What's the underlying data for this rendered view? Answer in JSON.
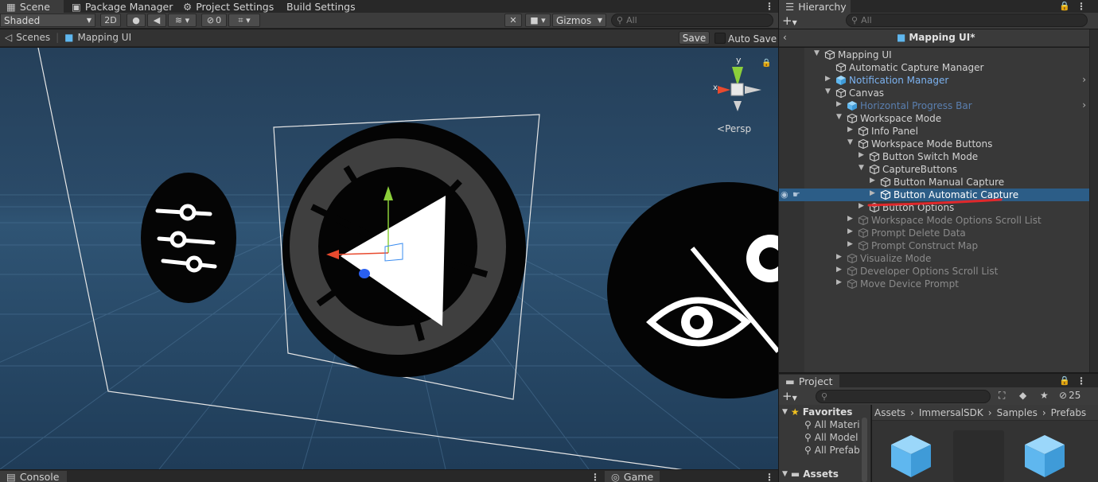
{
  "scene_panel": {
    "tabs": [
      {
        "label": "Scene",
        "icon": "hash-icon",
        "active": true
      },
      {
        "label": "Package Manager",
        "icon": "package-icon"
      },
      {
        "label": "Project Settings",
        "icon": "gear-icon"
      },
      {
        "label": "Build Settings"
      }
    ],
    "toolbar": {
      "shading_mode": "Shaded",
      "mode_2d": "2D",
      "hidden_count": "0",
      "gizmos_label": "Gizmos",
      "search_placeholder": "All"
    },
    "breadcrumb": {
      "root": "Scenes",
      "current": "Mapping UI",
      "save_label": "Save",
      "auto_save_label": "Auto Save"
    },
    "viewport": {
      "projection_label": "Persp",
      "axis_x": "x",
      "axis_y": "y"
    }
  },
  "hierarchy": {
    "tab_label": "Hierarchy",
    "search_placeholder": "All",
    "header_title": "Mapping UI*",
    "items": [
      {
        "label": "Mapping UI",
        "depth": 0,
        "expanded": true,
        "has_children": true,
        "style": "normal"
      },
      {
        "label": "Automatic Capture Manager",
        "depth": 1,
        "has_children": false,
        "style": "normal"
      },
      {
        "label": "Notification Manager",
        "depth": 1,
        "expanded": false,
        "has_children": true,
        "style": "prefab",
        "chevron": true
      },
      {
        "label": "Canvas",
        "depth": 1,
        "expanded": true,
        "has_children": true,
        "style": "normal"
      },
      {
        "label": "Horizontal Progress Bar",
        "depth": 2,
        "expanded": false,
        "has_children": true,
        "style": "prefab-dim",
        "chevron": true
      },
      {
        "label": "Workspace Mode",
        "depth": 2,
        "expanded": true,
        "has_children": true,
        "style": "normal"
      },
      {
        "label": "Info Panel",
        "depth": 3,
        "expanded": false,
        "has_children": true,
        "style": "normal"
      },
      {
        "label": "Workspace Mode Buttons",
        "depth": 3,
        "expanded": true,
        "has_children": true,
        "style": "normal"
      },
      {
        "label": "Button Switch Mode",
        "depth": 4,
        "expanded": false,
        "has_children": true,
        "style": "normal"
      },
      {
        "label": "CaptureButtons",
        "depth": 4,
        "expanded": true,
        "has_children": true,
        "style": "normal"
      },
      {
        "label": "Button Manual Capture",
        "depth": 5,
        "expanded": false,
        "has_children": true,
        "style": "normal"
      },
      {
        "label": "Button Automatic Capture",
        "depth": 5,
        "expanded": false,
        "has_children": true,
        "style": "selected"
      },
      {
        "label": "Button Options",
        "depth": 4,
        "expanded": false,
        "has_children": true,
        "style": "normal"
      },
      {
        "label": "Workspace Mode Options Scroll List",
        "depth": 3,
        "expanded": false,
        "has_children": true,
        "style": "inactive"
      },
      {
        "label": "Prompt Delete Data",
        "depth": 3,
        "expanded": false,
        "has_children": true,
        "style": "inactive"
      },
      {
        "label": "Prompt Construct Map",
        "depth": 3,
        "expanded": false,
        "has_children": true,
        "style": "inactive"
      },
      {
        "label": "Visualize Mode",
        "depth": 2,
        "expanded": false,
        "has_children": true,
        "style": "inactive"
      },
      {
        "label": "Developer Options Scroll List",
        "depth": 2,
        "expanded": false,
        "has_children": true,
        "style": "inactive"
      },
      {
        "label": "Move Device Prompt",
        "depth": 2,
        "expanded": false,
        "has_children": true,
        "style": "inactive"
      }
    ]
  },
  "project": {
    "tab_label": "Project",
    "hidden_count": "25",
    "favorites_label": "Favorites",
    "favorites": [
      "All Materi",
      "All Model",
      "All Prefab"
    ],
    "assets_label": "Assets",
    "breadcrumb": [
      "Assets",
      "ImmersalSDK",
      "Samples",
      "Prefabs"
    ]
  },
  "bottom": {
    "console_label": "Console",
    "game_label": "Game"
  },
  "colors": {
    "selection": "#2c5d87",
    "prefab_text": "#7cb2f0",
    "annotation_red": "#e0282b",
    "viewport_bg": "#22405c"
  }
}
